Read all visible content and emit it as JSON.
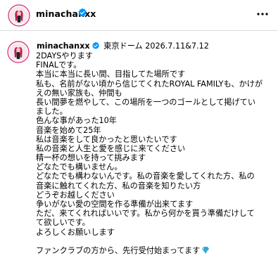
{
  "header": {
    "username": "minachanxx",
    "verified_icon": "verified-badge-icon",
    "more_icon": "more-options-icon"
  },
  "caption": {
    "username": "minachanxx",
    "location_date": "東京ドーム 2026.7.11&7.12",
    "lines": [
      "2DAYSやります",
      "FINALです。",
      "本当に本当に長い間、目指してた場所です",
      "私も、名前がない頃から信じてくれたROYAL FAMILYも、かけが",
      "えの無い家族も、仲間も",
      "長い間夢を燃やして、この場所を一つのゴールとして掲げてい",
      "ました。",
      "色んな事があった10年",
      "音楽を始めて25年",
      "私は音楽をして良かったと思いたいです",
      "私の音楽と人生と愛を感じに来てください",
      "精一杯の想いを持って挑みます",
      "どなたでも構いません。",
      "どなたでも構わないんです。私の音楽を愛してくれた方、私の",
      "音楽に触れてくれた方、私の音楽を知りたい方",
      "どうぞお越しください",
      "争いがない愛の空間を作る準備が出来てます",
      "ただ、来てくれればいいです。私から何かを貰う準備だけして",
      "て欲しいです。",
      "よろしくお願いします",
      "",
      "ファンクラブの方から、先行受付始まってます"
    ],
    "final_icon": "gem-icon"
  },
  "colors": {
    "verified": "#0095f6",
    "avatar_ring": "#d62976",
    "divider": "#dbdbdb",
    "gem": "#3fb7e8"
  }
}
